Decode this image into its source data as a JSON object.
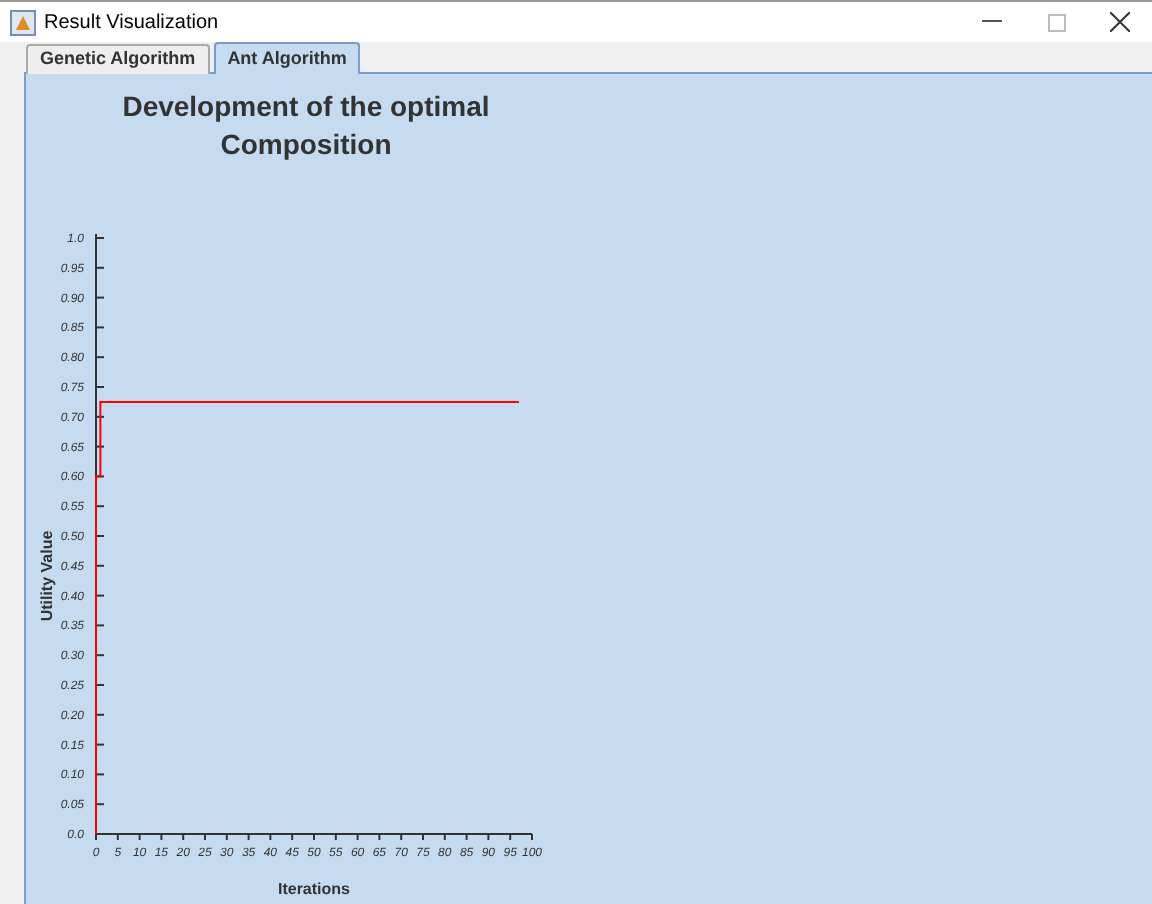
{
  "window": {
    "title": "Result Visualization"
  },
  "tabs": [
    {
      "label": "Genetic Algorithm",
      "selected": false
    },
    {
      "label": "Ant Algorithm",
      "selected": true
    }
  ],
  "chart": {
    "chart_data": {
      "type": "line",
      "title": "Development of the optimal Composition",
      "xlabel": "Iterations",
      "ylabel": "Utility Value",
      "xlim": [
        0,
        100
      ],
      "ylim": [
        0,
        1
      ],
      "xticks": [
        0,
        5,
        10,
        15,
        20,
        25,
        30,
        35,
        40,
        45,
        50,
        55,
        60,
        65,
        70,
        75,
        80,
        85,
        90,
        95,
        100
      ],
      "yticks": [
        {
          "value": 0,
          "label": "0.0"
        },
        {
          "value": 0.05,
          "label": "0.05"
        },
        {
          "value": 0.1,
          "label": "0.10"
        },
        {
          "value": 0.15,
          "label": "0.15"
        },
        {
          "value": 0.2,
          "label": "0.20"
        },
        {
          "value": 0.25,
          "label": "0.25"
        },
        {
          "value": 0.3,
          "label": "0.30"
        },
        {
          "value": 0.35,
          "label": "0.35"
        },
        {
          "value": 0.4,
          "label": "0.40"
        },
        {
          "value": 0.45,
          "label": "0.45"
        },
        {
          "value": 0.5,
          "label": "0.50"
        },
        {
          "value": 0.55,
          "label": "0.55"
        },
        {
          "value": 0.6,
          "label": "0.60"
        },
        {
          "value": 0.65,
          "label": "0.65"
        },
        {
          "value": 0.7,
          "label": "0.70"
        },
        {
          "value": 0.75,
          "label": "0.75"
        },
        {
          "value": 0.8,
          "label": "0.80"
        },
        {
          "value": 0.85,
          "label": "0.85"
        },
        {
          "value": 0.9,
          "label": "0.90"
        },
        {
          "value": 0.95,
          "label": "0.95"
        },
        {
          "value": 1,
          "label": "1.0"
        }
      ],
      "x": [
        0,
        0,
        1,
        1,
        97
      ],
      "series": [
        {
          "color": "#ff0000",
          "values": [
            0,
            0.6,
            0.6,
            0.725,
            0.725
          ]
        }
      ]
    }
  }
}
